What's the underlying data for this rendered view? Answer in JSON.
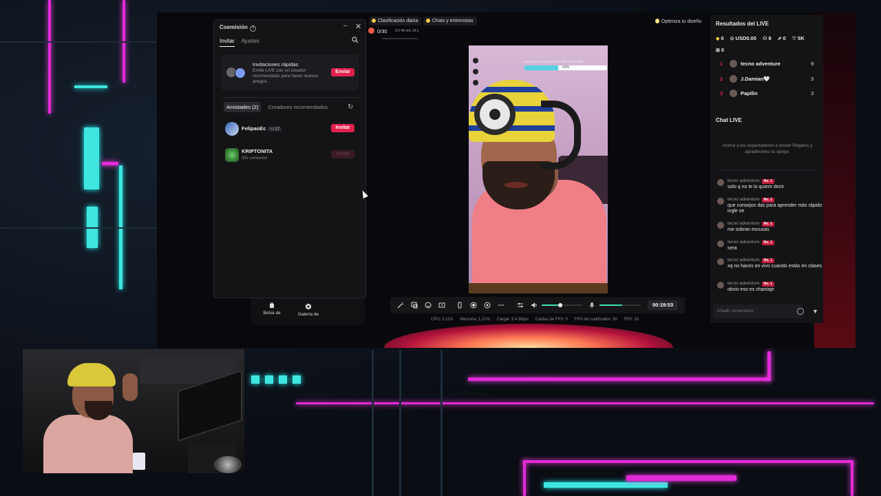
{
  "invite_panel": {
    "title": "Coemisión",
    "tabs": [
      "Invitar",
      "Ajustes"
    ],
    "quick": {
      "title": "Invitaciones rápidas",
      "desc": "Emite LIVE con un creador recomendado para hacer nuevos amigos",
      "button": "Enviar"
    },
    "friend_tabs": [
      "Amistades (2)",
      "Creadores recomendados"
    ],
    "friends": [
      {
        "name": "FelipaoEc",
        "badge": "17",
        "status": "",
        "button": "Invitar"
      },
      {
        "name": "KRIPTONITA",
        "badge": "",
        "status": "Sin conexión",
        "button": "Invitar"
      }
    ]
  },
  "mini_toolbar": [
    {
      "label": "Bolsa de",
      "icon": "bag-icon"
    },
    {
      "label": "Galería de",
      "icon": "gallery-icon"
    }
  ],
  "top_bar": {
    "ranking": "Clasificación diaria",
    "chats": "Chats y entrevistas",
    "gift_progress": "0/30",
    "gift_timer": "3 h 46 min 14 s",
    "optimize": "Optimiza tu diseño"
  },
  "video_overlay": {
    "goal_text": "solo que hora te espero en kick 2064/2000",
    "goal_progress": 0.41,
    "goal_label": "41%"
  },
  "controls": {
    "timer": "00:19:53",
    "volume": 0.4,
    "mic_volume": 0.55
  },
  "stats": {
    "cpu": "CPU: 2.11%",
    "memory": "Memoria: 1.21%",
    "upload": "Cargar: 5.4 Mbps",
    "fps_drop": "Caídas de FPS: 0",
    "encoder_fps": "FPS del codificador: 30",
    "fps": "FPS: 30"
  },
  "live_results": {
    "title": "Resultados del LIVE",
    "diamonds": "0",
    "usd": "USD0.00",
    "viewers": "9",
    "shares": "0",
    "likes": "5K",
    "gifts": "0",
    "ranking": [
      {
        "rank": "1",
        "name": "tecno adventure",
        "score": "9"
      },
      {
        "rank": "2",
        "name": "J.Damian🤍",
        "score": "3"
      },
      {
        "rank": "3",
        "name": "Papilin",
        "score": "3"
      }
    ]
  },
  "chat": {
    "title": "Chat LIVE",
    "hint": "Anima a los espectadores a enviar Regalos y agradéceles su apoyo.",
    "badge": "No. 1",
    "messages": [
      {
        "user": "tecno adventure",
        "text": "solo q no te lo quiere decir"
      },
      {
        "user": "tecno adventure",
        "text": "que consejos das para aprender más rápido ingle oe"
      },
      {
        "user": "tecno adventure",
        "text": "me sobran escusas"
      },
      {
        "user": "tecno adventure",
        "text": "sera"
      },
      {
        "user": "tecno adventure",
        "text": "xq no haces en vivo cuando estás en clases"
      },
      {
        "user": "tecno adventure",
        "text": "obvio eso es chantaje"
      }
    ],
    "input_placeholder": "Añadir comentario"
  },
  "colors": {
    "accent": "#e0214f",
    "teal": "#3fe0b0",
    "panel": "#141417"
  }
}
